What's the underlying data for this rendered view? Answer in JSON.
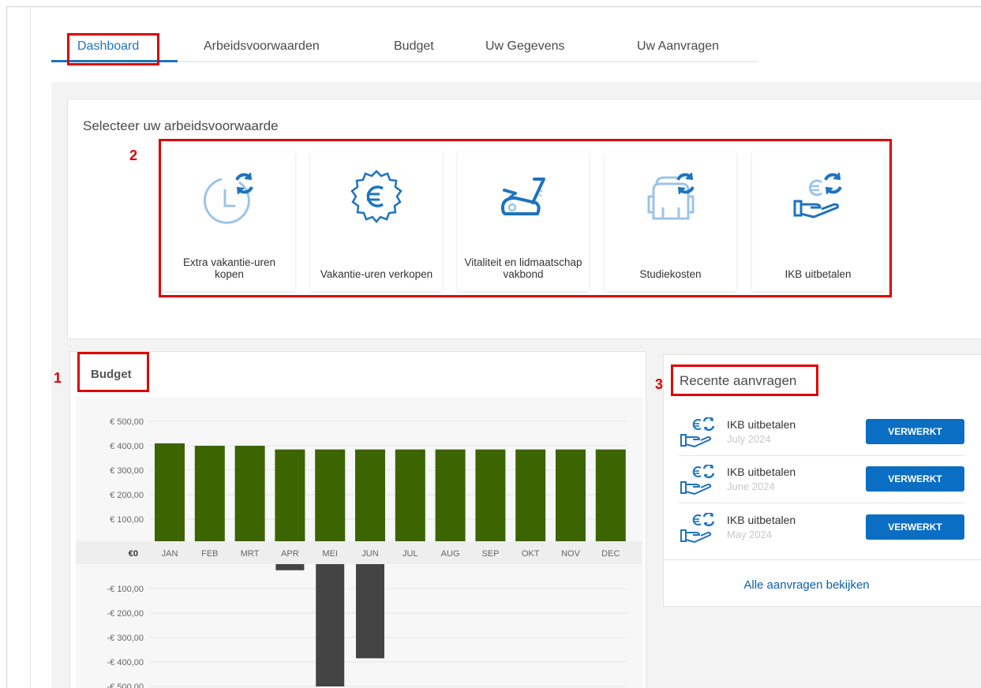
{
  "tabs": [
    {
      "label": "Dashboard",
      "active": true
    },
    {
      "label": "Arbeidsvoorwaarden"
    },
    {
      "label": "Budget"
    },
    {
      "label": "Uw Gegevens"
    },
    {
      "label": "Uw Aanvragen"
    }
  ],
  "select": {
    "title": "Selecteer uw arbeidsvoorwaarde",
    "tiles": [
      {
        "label": "Extra vakantie-uren kopen",
        "icon": "clock-refresh-icon"
      },
      {
        "label": "Vakantie-uren verkopen",
        "icon": "euro-badge-icon"
      },
      {
        "label": "Vitaliteit en lidmaatschap vakbond",
        "icon": "exercise-bike-icon"
      },
      {
        "label": "Studiekosten",
        "icon": "backpack-refresh-icon"
      },
      {
        "label": "IKB uitbetalen",
        "icon": "hand-euro-refresh-icon"
      }
    ]
  },
  "annotations": {
    "n1": "1",
    "n2": "2",
    "n3": "3"
  },
  "budget": {
    "title": "Budget"
  },
  "chart_data": {
    "type": "bar",
    "categories": [
      "JAN",
      "FEB",
      "MRT",
      "APR",
      "MEI",
      "JUN",
      "JUL",
      "AUG",
      "SEP",
      "OKT",
      "NOV",
      "DEC"
    ],
    "series": [
      {
        "values": [
          410,
          400,
          400,
          385,
          385,
          385,
          385,
          385,
          385,
          385,
          385,
          385
        ],
        "color": "#3c6400"
      },
      {
        "values": [
          0,
          0,
          0,
          -25,
          -500,
          -385,
          0,
          0,
          0,
          0,
          0,
          0
        ],
        "color": "#444444"
      }
    ],
    "yticks_positive": [
      "€ 500,00",
      "€ 400,00",
      "€ 300,00",
      "€ 200,00",
      "€ 100,00"
    ],
    "zero_label": "€0",
    "yticks_negative": [
      "-€ 100,00",
      "-€ 200,00",
      "-€ 300,00",
      "-€ 400,00",
      "-€ 500,00"
    ],
    "ylim": [
      -500,
      500
    ],
    "grid": true
  },
  "recent": {
    "title": "Recente aanvragen",
    "items": [
      {
        "name": "IKB uitbetalen",
        "date": "July 2024",
        "status": "VERWERKT"
      },
      {
        "name": "IKB uitbetalen",
        "date": "June 2024",
        "status": "VERWERKT"
      },
      {
        "name": "IKB uitbetalen",
        "date": "May 2024",
        "status": "VERWERKT"
      }
    ],
    "all_link": "Alle aanvragen bekijken"
  },
  "colors": {
    "accent": "#1e73be",
    "button": "#0a6ec2",
    "annotation": "#e00000",
    "positive_bar": "#3c6400",
    "negative_bar": "#444444"
  }
}
